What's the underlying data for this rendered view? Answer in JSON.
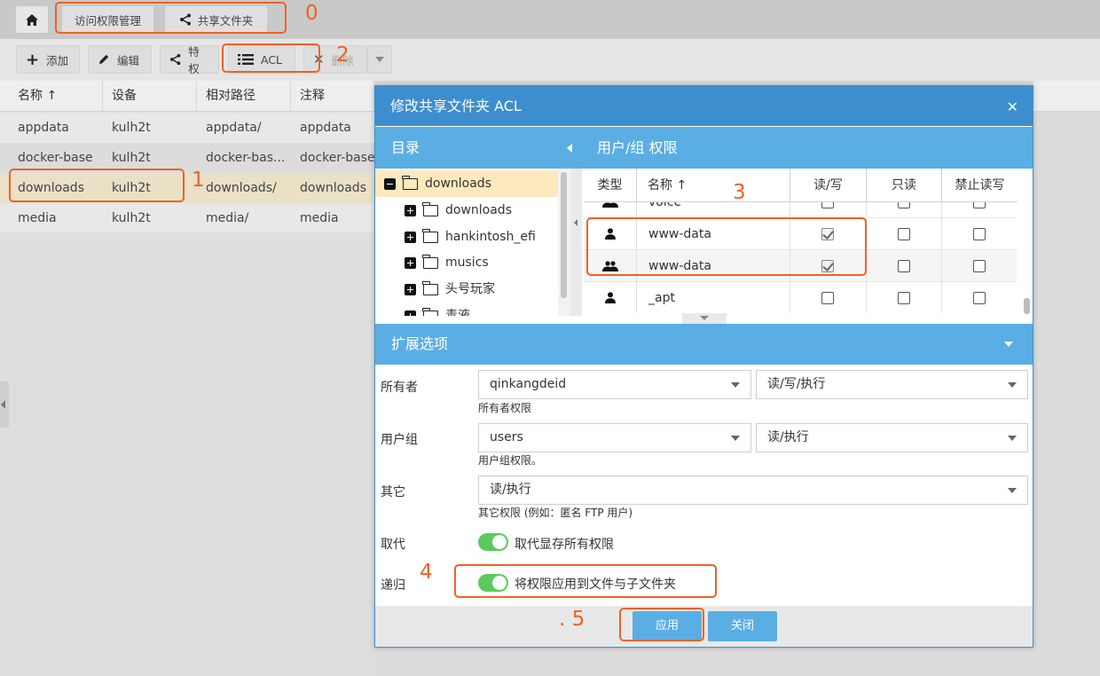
{
  "topbar": {
    "tab_access": "访问权限管理",
    "tab_shared": "共享文件夹"
  },
  "toolbar": {
    "add": "添加",
    "edit": "编辑",
    "privilege": "特权",
    "acl": "ACL",
    "delete": "删除"
  },
  "table": {
    "headers": [
      "名称 ↑",
      "设备",
      "相对路径",
      "注释"
    ],
    "rows": [
      [
        "appdata",
        "kulh2t",
        "appdata/",
        "appdata"
      ],
      [
        "docker-base",
        "kulh2t",
        "docker-bas...",
        "docker-base"
      ],
      [
        "downloads",
        "kulh2t",
        "downloads/",
        "downloads"
      ],
      [
        "media",
        "kulh2t",
        "media/",
        "media"
      ]
    ]
  },
  "dialog": {
    "title": "修改共享文件夹 ACL",
    "dir_panel_title": "目录",
    "perm_panel_title": "用户/组 权限",
    "tree": {
      "root": "downloads",
      "children": [
        "downloads",
        "hankintosh_efi",
        "musics",
        "头号玩家",
        "毒液"
      ]
    },
    "acl_headers": [
      "类型",
      "名称 ↑",
      "读/写",
      "只读",
      "禁止读写"
    ],
    "acl_rows": [
      {
        "type": "group-icon",
        "name": "voice",
        "rw": false,
        "ro": false,
        "deny": false
      },
      {
        "type": "user-icon",
        "name": "www-data",
        "rw": true,
        "ro": false,
        "deny": false
      },
      {
        "type": "group-icon",
        "name": "www-data",
        "rw": true,
        "ro": false,
        "deny": false
      },
      {
        "type": "user-icon",
        "name": "_apt",
        "rw": false,
        "ro": false,
        "deny": false
      }
    ],
    "extended_title": "扩展选项",
    "owner": {
      "label": "所有者",
      "value": "qinkangdeid",
      "perm": "读/写/执行",
      "hint": "所有者权限"
    },
    "group": {
      "label": "用户组",
      "value": "users",
      "perm": "读/执行",
      "hint": "用户组权限。"
    },
    "other": {
      "label": "其它",
      "perm": "读/执行",
      "hint": "其它权限 (例如：匿名 FTP 用户)"
    },
    "replace": {
      "label": "取代",
      "text": "取代显存所有权限",
      "on": true
    },
    "recursive": {
      "label": "递归",
      "text": "将权限应用到文件与子文件夹",
      "on": true
    },
    "apply": "应用",
    "close": "关闭"
  },
  "annotations": [
    "0",
    "1",
    "2",
    "3",
    "4",
    ". 5"
  ],
  "colors": {
    "accent": "#3d8ecf",
    "panel": "#5baee4",
    "annotation": "#f06123",
    "toggle": "#5cc95f",
    "selected_row": "#e9e0c6"
  }
}
